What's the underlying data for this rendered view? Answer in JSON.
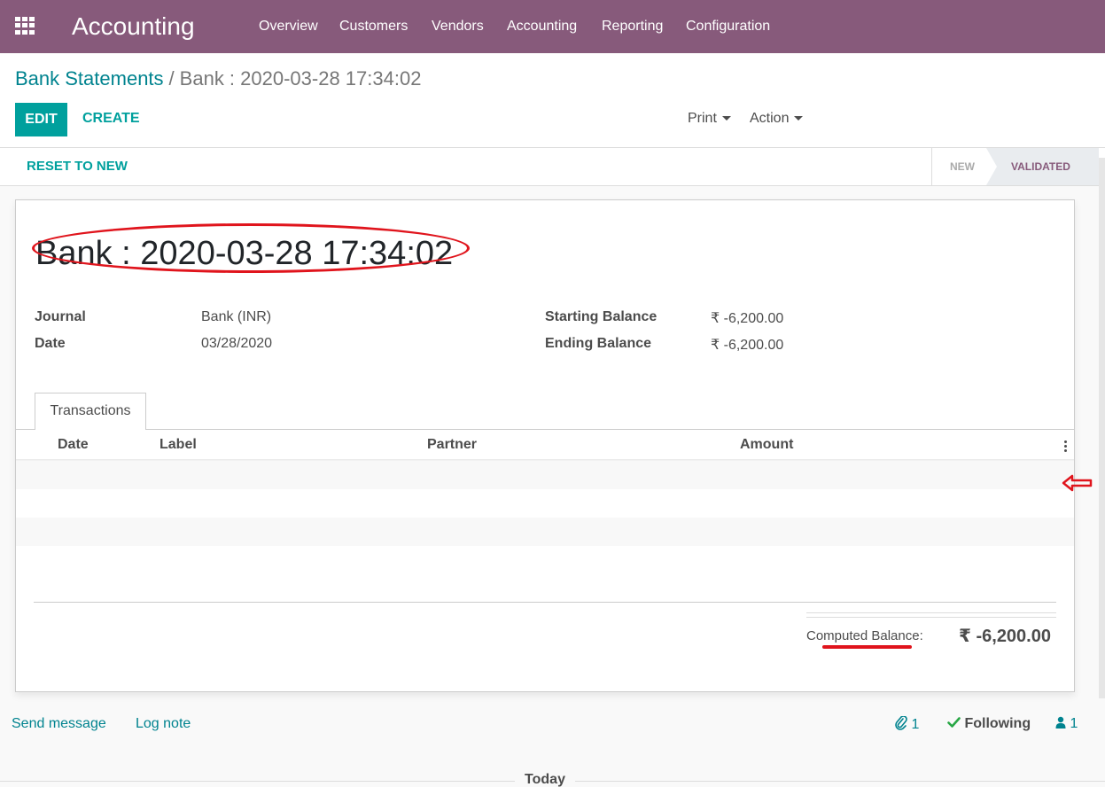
{
  "nav": {
    "app_title": "Accounting",
    "items": [
      "Overview",
      "Customers",
      "Vendors",
      "Accounting",
      "Reporting",
      "Configuration"
    ]
  },
  "breadcrumb": {
    "parent": "Bank Statements",
    "separator": "/",
    "current": "Bank : 2020-03-28 17:34:02"
  },
  "toolbar": {
    "edit_label": "EDIT",
    "create_label": "CREATE",
    "print_label": "Print",
    "action_label": "Action"
  },
  "statusbar": {
    "reset_label": "RESET TO NEW",
    "stages": [
      "NEW",
      "VALIDATED"
    ],
    "active_stage": "VALIDATED"
  },
  "form": {
    "title": "Bank : 2020-03-28 17:34:02",
    "journal_label": "Journal",
    "journal_value": "Bank (INR)",
    "date_label": "Date",
    "date_value": "03/28/2020",
    "starting_balance_label": "Starting Balance",
    "starting_balance_value": "₹ -6,200.00",
    "ending_balance_label": "Ending Balance",
    "ending_balance_value": "₹ -6,200.00"
  },
  "tabs": {
    "transactions": "Transactions"
  },
  "table": {
    "columns": [
      "Date",
      "Label",
      "Partner",
      "Amount"
    ],
    "rows": []
  },
  "totals": {
    "computed_balance_label": "Computed Balance:",
    "computed_balance_value": "₹ -6,200.00"
  },
  "chatter": {
    "send_message": "Send message",
    "log_note": "Log note",
    "attachments_count": "1",
    "following_label": "Following",
    "followers_count": "1",
    "today_label": "Today"
  },
  "colors": {
    "brand": "#875a7b",
    "accent": "#00a09d",
    "annotation": "#e0141c"
  }
}
